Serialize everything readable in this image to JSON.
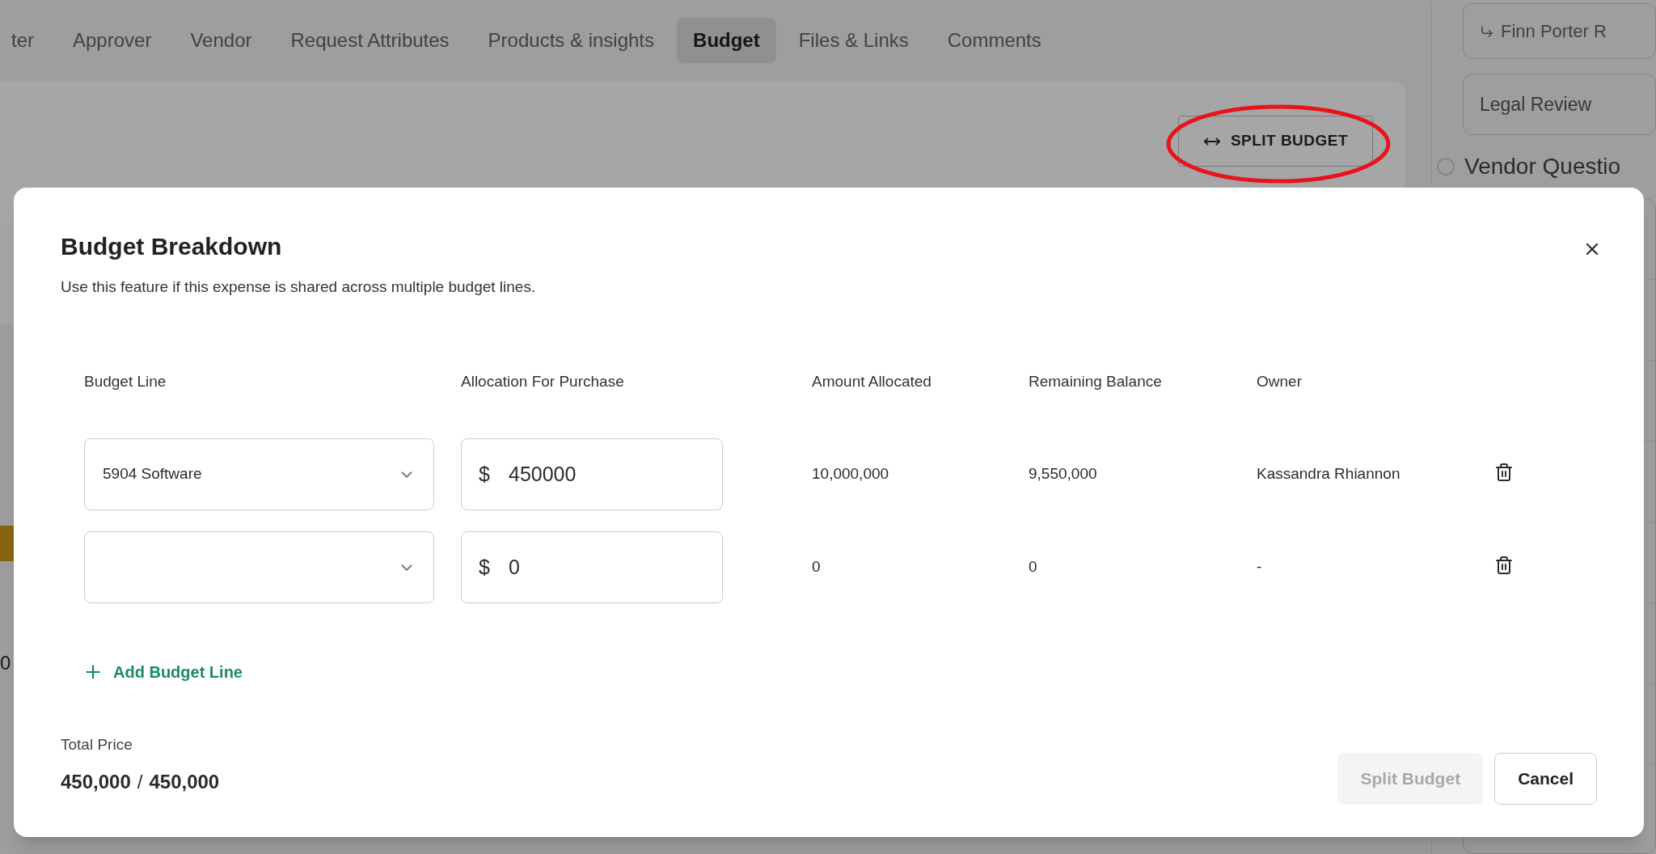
{
  "tabs": [
    {
      "label": "ter",
      "selected": false
    },
    {
      "label": "Approver",
      "selected": false
    },
    {
      "label": "Vendor",
      "selected": false
    },
    {
      "label": "Request Attributes",
      "selected": false
    },
    {
      "label": "Products & insights",
      "selected": false
    },
    {
      "label": "Budget",
      "selected": true
    },
    {
      "label": "Files & Links",
      "selected": false
    },
    {
      "label": "Comments",
      "selected": false
    }
  ],
  "split_button": {
    "label": "SPLIT BUDGET"
  },
  "left_fragments": [
    "0"
  ],
  "side_panel": {
    "approver": "Finn Porter R",
    "review": "Legal Review",
    "section": "Vendor Questio"
  },
  "modal": {
    "title": "Budget Breakdown",
    "subtitle": "Use this feature if this expense is shared across multiple budget lines.",
    "columns": [
      "Budget Line",
      "Allocation For Purchase",
      "Amount Allocated",
      "Remaining Balance",
      "Owner"
    ],
    "rows": [
      {
        "budget_line": "5904 Software",
        "currency": "$",
        "allocation": "450000",
        "amount_allocated": "10,000,000",
        "remaining_balance": "9,550,000",
        "owner": "Kassandra Rhiannon"
      },
      {
        "budget_line": "",
        "currency": "$",
        "allocation": "0",
        "amount_allocated": "0",
        "remaining_balance": "0",
        "owner": "-"
      }
    ],
    "add_line": "Add Budget Line",
    "total_label": "Total Price",
    "total_value": "450,000",
    "total_separator": "/",
    "total_target": "450,000",
    "buttons": [
      {
        "label": "Split Budget",
        "disabled": true
      },
      {
        "label": "Cancel",
        "disabled": false
      }
    ]
  }
}
